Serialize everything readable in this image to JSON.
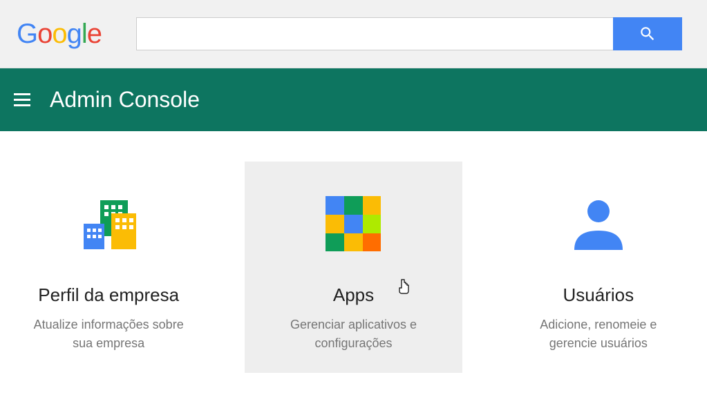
{
  "logo_text": "Google",
  "search": {
    "value": "",
    "placeholder": ""
  },
  "nav": {
    "title": "Admin Console"
  },
  "cards": [
    {
      "title": "Perfil da empresa",
      "desc": "Atualize informações sobre sua empresa"
    },
    {
      "title": "Apps",
      "desc": "Gerenciar aplicativos e configurações"
    },
    {
      "title": "Usuários",
      "desc": "Adicione, renomeie e gerencie usuários"
    }
  ]
}
